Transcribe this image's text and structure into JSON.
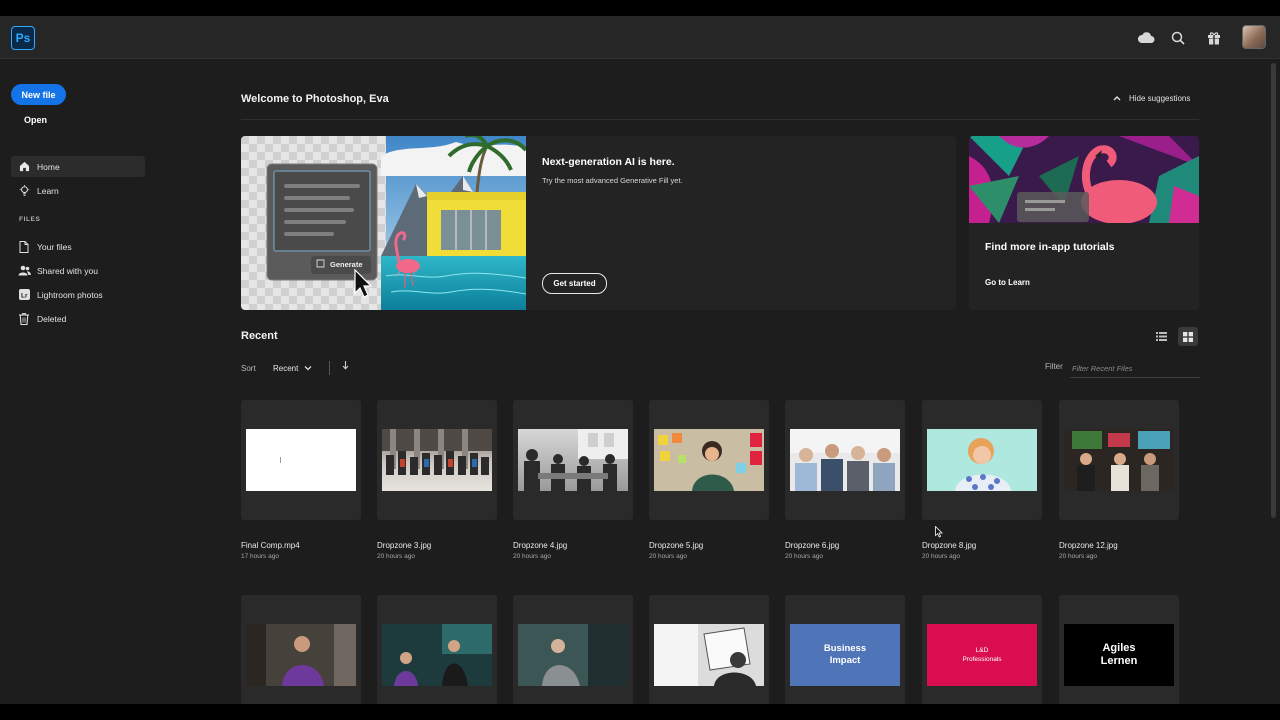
{
  "topbar": {
    "app_logo": "Ps",
    "icons": [
      "cloud-icon",
      "search-icon",
      "gift-icon"
    ]
  },
  "sidebar": {
    "new_file": "New file",
    "open": "Open",
    "nav": [
      {
        "label": "Home",
        "icon": "home-icon",
        "active": true
      },
      {
        "label": "Learn",
        "icon": "lightbulb-icon",
        "active": false
      }
    ],
    "files_section": "FILES",
    "files": [
      {
        "label": "Your files",
        "icon": "file-icon"
      },
      {
        "label": "Shared with you",
        "icon": "people-icon"
      },
      {
        "label": "Lightroom photos",
        "icon": "lightroom-icon"
      },
      {
        "label": "Deleted",
        "icon": "trash-icon"
      }
    ]
  },
  "main": {
    "welcome": "Welcome to Photoshop, Eva",
    "hide_suggestions": "Hide suggestions",
    "hero": {
      "title": "Next-generation AI is here.",
      "subtitle": "Try the most advanced Generative Fill yet.",
      "button": "Get started",
      "generate_label": "Generate"
    },
    "tutorial": {
      "title": "Find more in-app tutorials",
      "link": "Go to Learn"
    },
    "recent": {
      "title": "Recent",
      "sort_label": "Sort",
      "sort_value": "Recent",
      "filter_label": "Filter",
      "filter_placeholder": "Filter Recent Files",
      "files": [
        {
          "name": "Final Comp.mp4",
          "time": "17 hours ago"
        },
        {
          "name": "Dropzone 3.jpg",
          "time": "20 hours ago"
        },
        {
          "name": "Dropzone 4.jpg",
          "time": "20 hours ago"
        },
        {
          "name": "Dropzone 5.jpg",
          "time": "20 hours ago"
        },
        {
          "name": "Dropzone 6.jpg",
          "time": "20 hours ago"
        },
        {
          "name": "Dropzone 8.jpg",
          "time": "20 hours ago"
        },
        {
          "name": "Dropzone 12.jpg",
          "time": "20 hours ago"
        }
      ],
      "row2_thumbs": [
        {
          "text": ""
        },
        {
          "text": ""
        },
        {
          "text": ""
        },
        {
          "text": ""
        },
        {
          "text": "Business Impact"
        },
        {
          "text": "L&D Professionals"
        },
        {
          "text": "Agiles Lernen"
        }
      ]
    }
  },
  "colors": {
    "accent": "#1473e6",
    "background": "#1d1d1d",
    "topbar": "#262626",
    "card": "#232323"
  }
}
